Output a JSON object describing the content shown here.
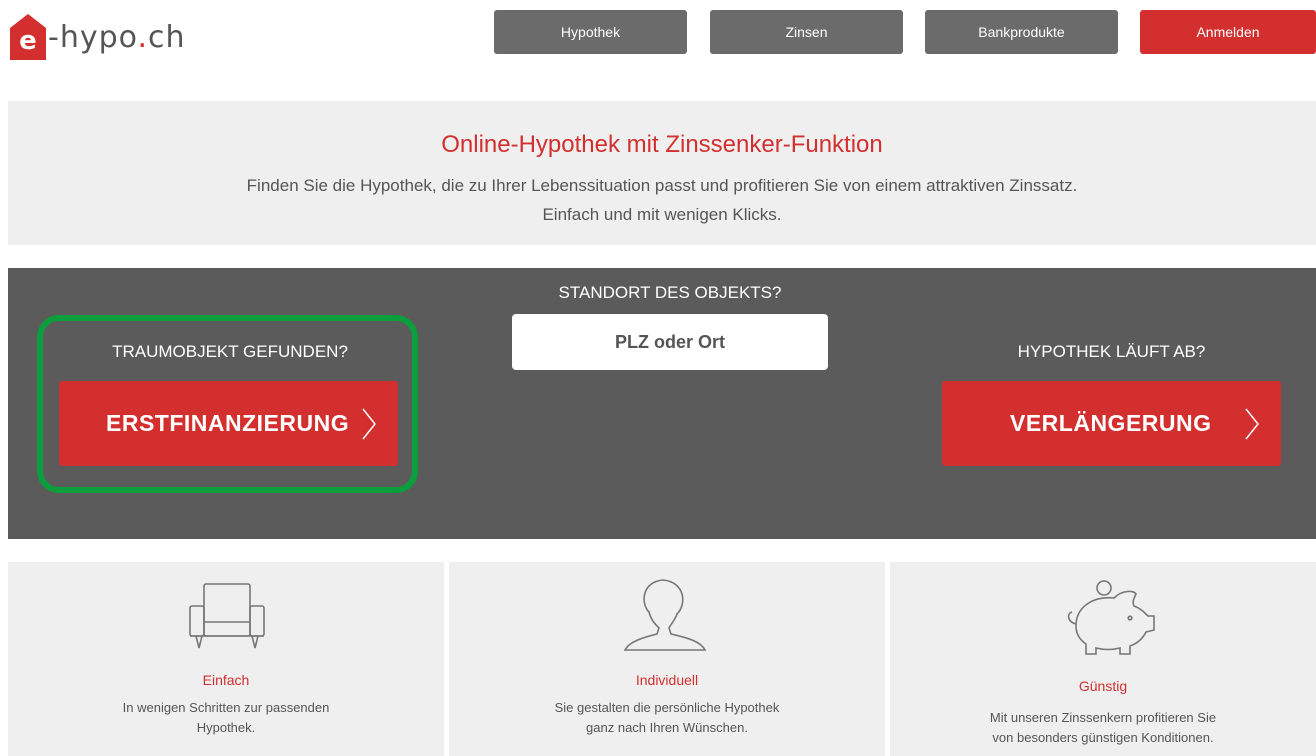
{
  "header": {
    "logo": {
      "mark": "e",
      "text": "-hypo",
      "dot": ".",
      "tld": "ch"
    },
    "nav": [
      {
        "label": "Hypothek"
      },
      {
        "label": "Zinsen"
      },
      {
        "label": "Bankprodukte"
      },
      {
        "label": "Anmelden"
      }
    ]
  },
  "intro": {
    "title": "Online-Hypothek mit Zinssenker-Funktion",
    "line1": "Finden Sie die Hypothek, die zu Ihrer Lebenssituation passt und profitieren Sie von einem attraktiven Zinssatz.",
    "line2": "Einfach und mit wenigen Klicks."
  },
  "panel": {
    "left_caption": "TRAUMOBJEKT GEFUNDEN?",
    "left_button": "ERSTFINANZIERUNG",
    "center_caption": "STANDORT DES OBJEKTS?",
    "location_placeholder": "PLZ oder Ort",
    "right_caption": "HYPOTHEK LÄUFT AB?",
    "right_button": "VERLÄNGERUNG"
  },
  "features": [
    {
      "icon": "armchair-icon",
      "title": "Einfach",
      "desc1": "In wenigen Schritten zur passenden",
      "desc2": "Hypothek."
    },
    {
      "icon": "person-icon",
      "title": "Individuell",
      "desc1": "Sie gestalten die persönliche Hypothek",
      "desc2": "ganz nach Ihren Wünschen."
    },
    {
      "icon": "piggy-bank-icon",
      "title": "Günstig",
      "desc1": "Mit unseren Zinssenkern profitieren Sie",
      "desc2": "von besonders günstigen Konditionen."
    }
  ],
  "colors": {
    "brand_red": "#d32f2f",
    "nav_gray": "#6b6b6b",
    "panel_gray": "#5b5b5b",
    "band_gray": "#efefef",
    "highlight_green": "#0a9e3c"
  }
}
